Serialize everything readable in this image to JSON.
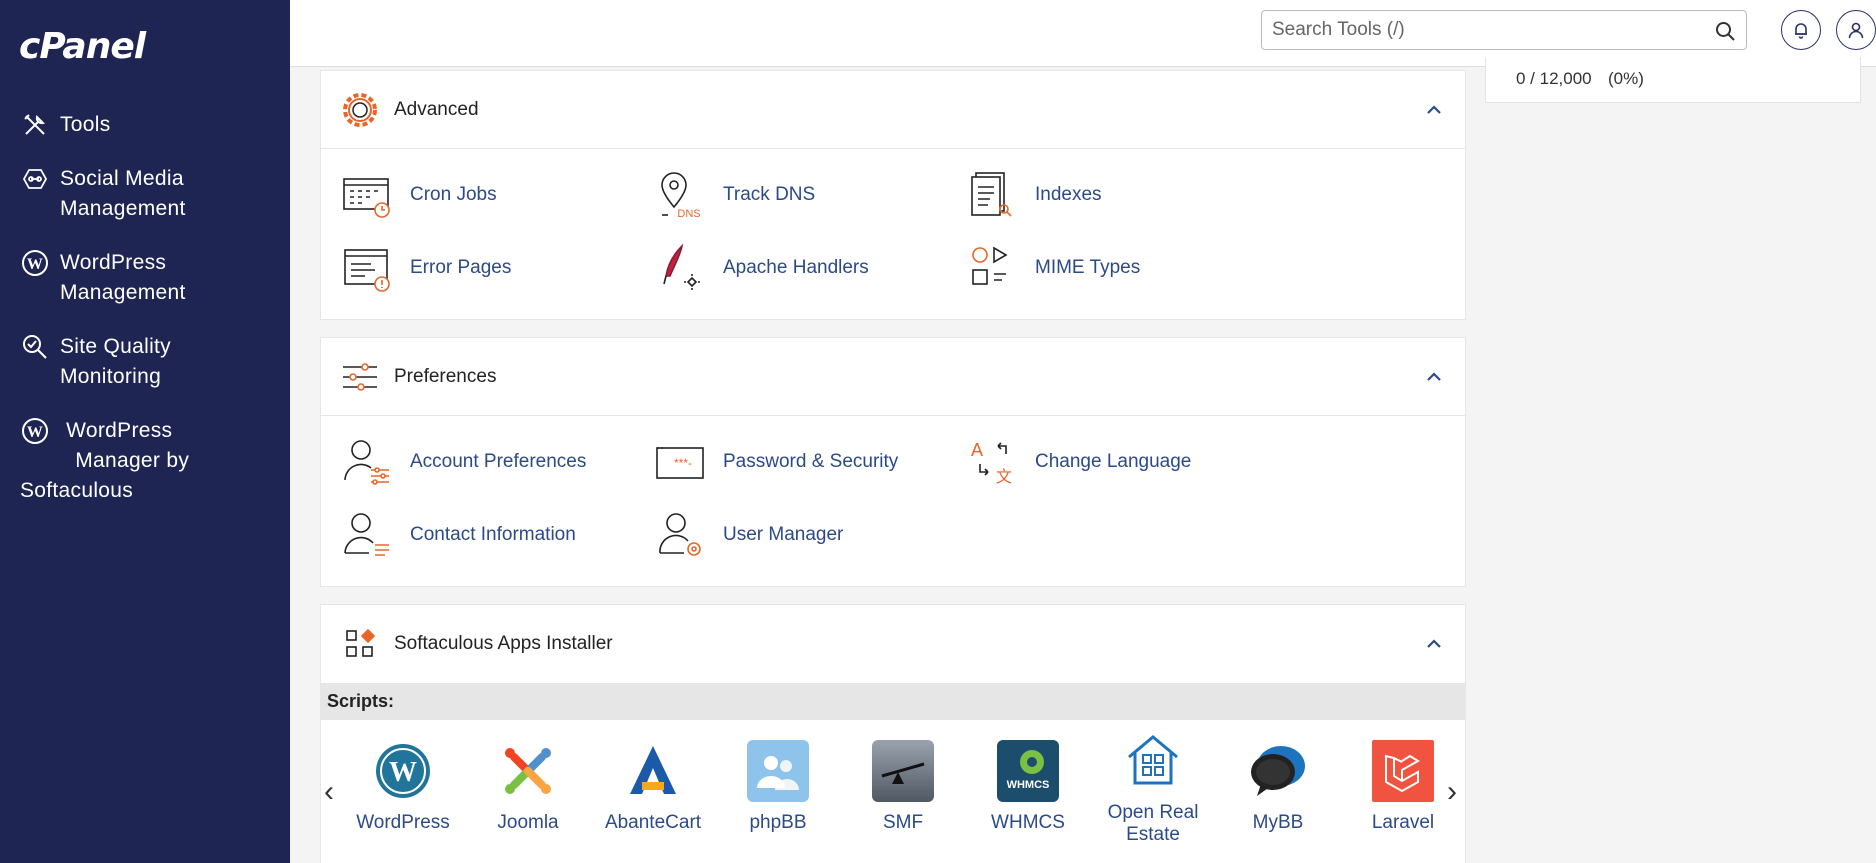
{
  "brand": {
    "logo_text": "cPanel"
  },
  "sidebar": {
    "items": [
      {
        "label": "Tools",
        "icon": "tools-icon"
      },
      {
        "label": "Social Media Management",
        "line1": "Social Media",
        "line2": "Management",
        "icon": "social-media-icon"
      },
      {
        "label": "WordPress Management",
        "line1": "WordPress",
        "line2": "Management",
        "icon": "wordpress-icon"
      },
      {
        "label": "Site Quality Monitoring",
        "line1": "Site Quality",
        "line2": "Monitoring",
        "icon": "site-quality-icon"
      },
      {
        "label": "WordPress Manager by Softaculous",
        "line1": "WordPress",
        "line2": "Manager by",
        "line3": "Softaculous",
        "icon": "wordpress-icon"
      }
    ]
  },
  "header": {
    "search_placeholder": "Search Tools (/)"
  },
  "stats": {
    "value": "0 / 12,000",
    "percent": "(0%)"
  },
  "colors": {
    "sidebar_bg": "#1f2552",
    "link": "#2b4a87",
    "accent": "#e8652a"
  },
  "sections": {
    "advanced": {
      "title": "Advanced",
      "tools": [
        {
          "label": "Cron Jobs",
          "icon": "cron-jobs-icon"
        },
        {
          "label": "Track DNS",
          "icon": "track-dns-icon"
        },
        {
          "label": "Indexes",
          "icon": "indexes-icon"
        },
        {
          "label": "Error Pages",
          "icon": "error-pages-icon"
        },
        {
          "label": "Apache Handlers",
          "icon": "apache-handlers-icon"
        },
        {
          "label": "MIME Types",
          "icon": "mime-types-icon"
        }
      ]
    },
    "preferences": {
      "title": "Preferences",
      "tools": [
        {
          "label": "Account Preferences",
          "icon": "account-preferences-icon"
        },
        {
          "label": "Password & Security",
          "icon": "password-security-icon"
        },
        {
          "label": "Change Language",
          "icon": "change-language-icon"
        },
        {
          "label": "Contact Information",
          "icon": "contact-information-icon"
        },
        {
          "label": "User Manager",
          "icon": "user-manager-icon"
        }
      ]
    },
    "softaculous": {
      "title": "Softaculous Apps Installer",
      "scripts_label": "Scripts:",
      "apps": [
        {
          "label": "WordPress",
          "icon": "wordpress-app-icon"
        },
        {
          "label": "Joomla",
          "icon": "joomla-app-icon"
        },
        {
          "label": "AbanteCart",
          "icon": "abantecart-app-icon"
        },
        {
          "label": "phpBB",
          "icon": "phpbb-app-icon"
        },
        {
          "label": "SMF",
          "icon": "smf-app-icon"
        },
        {
          "label": "WHMCS",
          "icon": "whmcs-app-icon",
          "badge": "WHMCS"
        },
        {
          "label": "Open Real Estate",
          "line1": "Open Real",
          "line2": "Estate",
          "icon": "open-real-estate-app-icon"
        },
        {
          "label": "MyBB",
          "icon": "mybb-app-icon"
        },
        {
          "label": "Laravel",
          "icon": "laravel-app-icon"
        }
      ]
    }
  }
}
